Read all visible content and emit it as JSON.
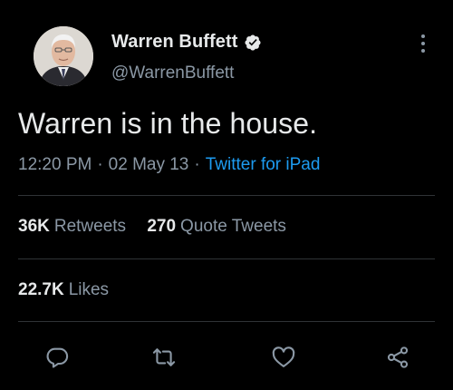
{
  "author": {
    "display_name": "Warren Buffett",
    "handle": "@WarrenBuffett",
    "verified": true,
    "avatar_icon": "profile-photo"
  },
  "tweet": {
    "text": "Warren is in the house.",
    "time": "12:20 PM",
    "separator": "·",
    "date": "02 May 13",
    "source": "Twitter for iPad"
  },
  "stats": {
    "retweets_count": "36K",
    "retweets_label": "Retweets",
    "quotes_count": "270",
    "quotes_label": "Quote Tweets",
    "likes_count": "22.7K",
    "likes_label": "Likes"
  },
  "actions": [
    {
      "name": "reply",
      "icon": "reply-icon"
    },
    {
      "name": "retweet",
      "icon": "retweet-icon"
    },
    {
      "name": "like",
      "icon": "heart-icon"
    },
    {
      "name": "share",
      "icon": "share-icon"
    }
  ],
  "colors": {
    "background": "#000000",
    "text_primary": "#e7e9ea",
    "text_secondary": "#8b98a5",
    "link": "#1d9bf0",
    "divider": "#2f3336"
  }
}
